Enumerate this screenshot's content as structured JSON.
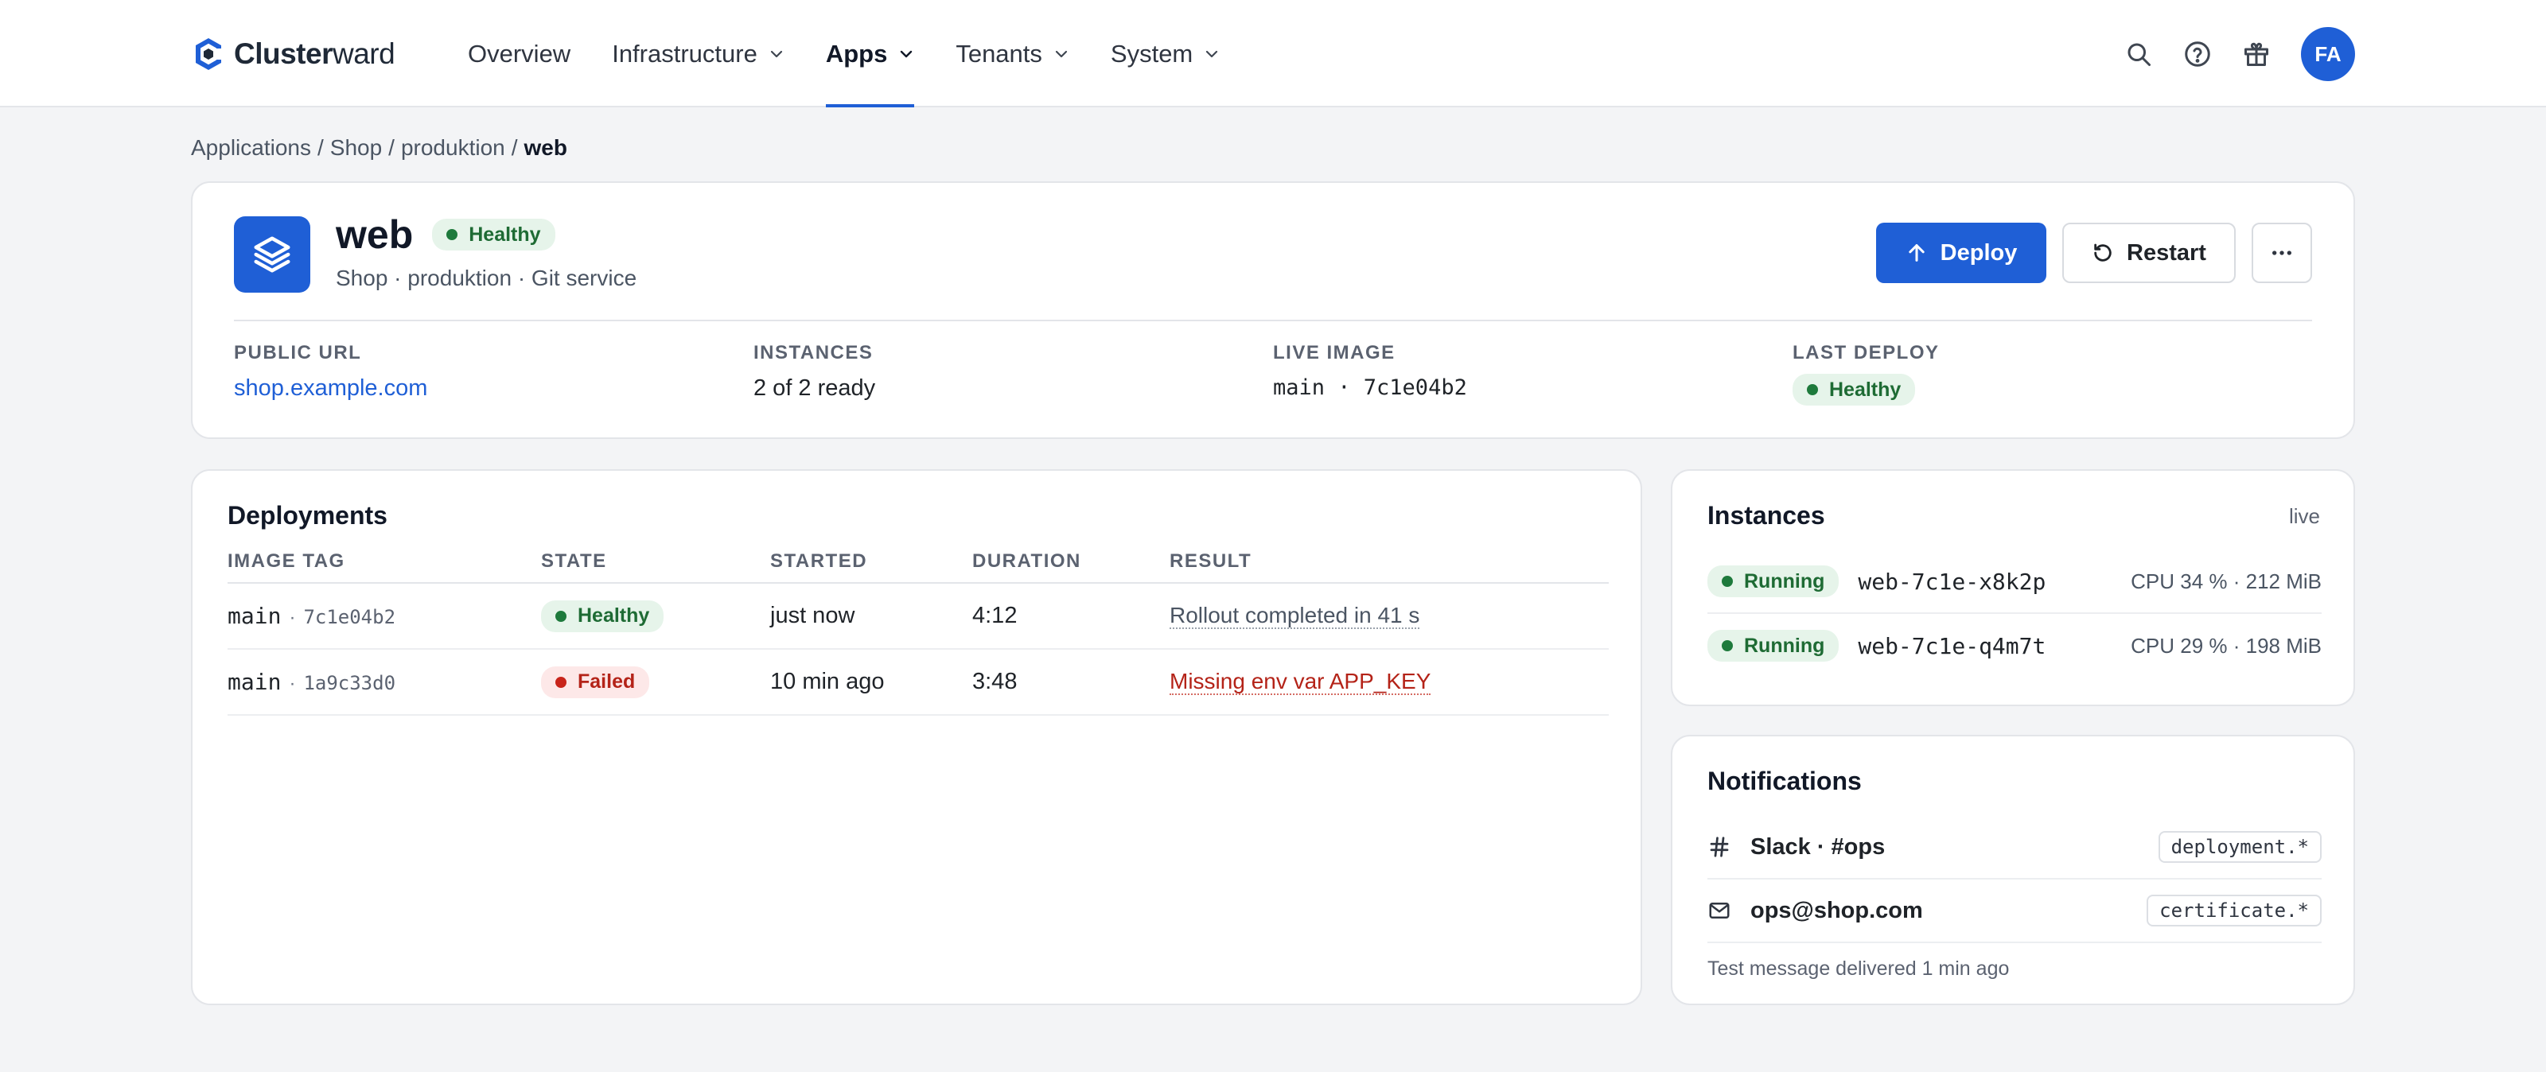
{
  "brand": {
    "name_bold": "Cluster",
    "name_light": "ward",
    "accent": "#1f5fd6"
  },
  "nav": {
    "items": [
      {
        "label": "Overview",
        "has_menu": false
      },
      {
        "label": "Infrastructure",
        "has_menu": true
      },
      {
        "label": "Apps",
        "has_menu": true,
        "active": true
      },
      {
        "label": "Tenants",
        "has_menu": true
      },
      {
        "label": "System",
        "has_menu": true
      }
    ],
    "icons": [
      "search-icon",
      "help-icon",
      "gift-icon"
    ],
    "avatar_initials": "FA"
  },
  "breadcrumb": {
    "items": [
      "Applications",
      "Shop",
      "produktion"
    ],
    "current": "web",
    "separator": "/"
  },
  "app": {
    "name": "web",
    "status": "Healthy",
    "subtitle": "Shop · produktion · Git service",
    "icon": "layers-icon",
    "actions": {
      "deploy": "Deploy",
      "restart": "Restart",
      "more_icon": "more-horizontal-icon"
    }
  },
  "meta": {
    "public_url": {
      "label": "PUBLIC URL",
      "value": "shop.example.com"
    },
    "instances": {
      "label": "INSTANCES",
      "value": "2 of 2 ready"
    },
    "live_image": {
      "label": "LIVE IMAGE",
      "value": "main · 7c1e04b2"
    },
    "last_deploy": {
      "label": "LAST DEPLOY",
      "value": "Healthy"
    }
  },
  "deployments": {
    "title": "Deployments",
    "columns": [
      "IMAGE TAG",
      "STATE",
      "STARTED",
      "DURATION",
      "RESULT"
    ],
    "rows": [
      {
        "branch": "main",
        "sep": "·",
        "hash": "7c1e04b2",
        "state": "Healthy",
        "started": "just now",
        "duration": "4:12",
        "result": "Rollout completed in 41 s"
      },
      {
        "branch": "main",
        "sep": "·",
        "hash": "1a9c33d0",
        "state": "Failed",
        "started": "10 min ago",
        "duration": "3:48",
        "result": "Missing env var APP_KEY"
      }
    ]
  },
  "instances": {
    "title": "Instances",
    "live_label": "live",
    "items": [
      {
        "status": "Running",
        "name": "web-7c1e-x8k2p",
        "usage": "CPU 34 % · 212 MiB"
      },
      {
        "status": "Running",
        "name": "web-7c1e-q4m7t",
        "usage": "CPU 29 % · 198 MiB"
      }
    ]
  },
  "notifications": {
    "title": "Notifications",
    "items": [
      {
        "icon": "hash-icon",
        "name": "Slack · #ops",
        "filter": "deployment.*"
      },
      {
        "icon": "mail-icon",
        "name": "ops@shop.com",
        "filter": "certificate.*"
      }
    ],
    "footer": "Test message delivered 1 min ago"
  },
  "colors": {
    "success_bg": "#e6f4ea",
    "success_fg": "#1e6b34",
    "danger_bg": "#fde8e8",
    "danger_fg": "#b42318"
  }
}
